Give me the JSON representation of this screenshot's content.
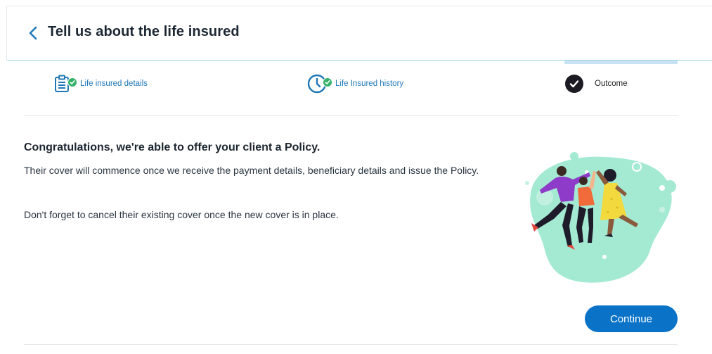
{
  "header": {
    "title": "Tell us about the life insured",
    "back_icon": "chevron-left-icon"
  },
  "stepper": {
    "steps": [
      {
        "label": "Life insured details",
        "icon": "clipboard-icon",
        "status": "complete"
      },
      {
        "label": "Life Insured history",
        "icon": "clock-icon",
        "status": "complete"
      },
      {
        "label": "Outcome",
        "icon": "check-circle-icon",
        "status": "active"
      }
    ]
  },
  "content": {
    "heading": "Congratulations, we're able to offer your client a Policy.",
    "paragraph1": "Their cover will commence once we receive the payment details, beneficiary details and issue the Policy.",
    "paragraph2": "Don't forget to cancel their existing cover once the new cover is in place."
  },
  "actions": {
    "continue_label": "Continue"
  },
  "colors": {
    "primary": "#0a73c8",
    "link": "#1f77b7",
    "success": "#35b36b",
    "dark": "#1c1b24",
    "accent_blob": "#9ee6cf"
  }
}
